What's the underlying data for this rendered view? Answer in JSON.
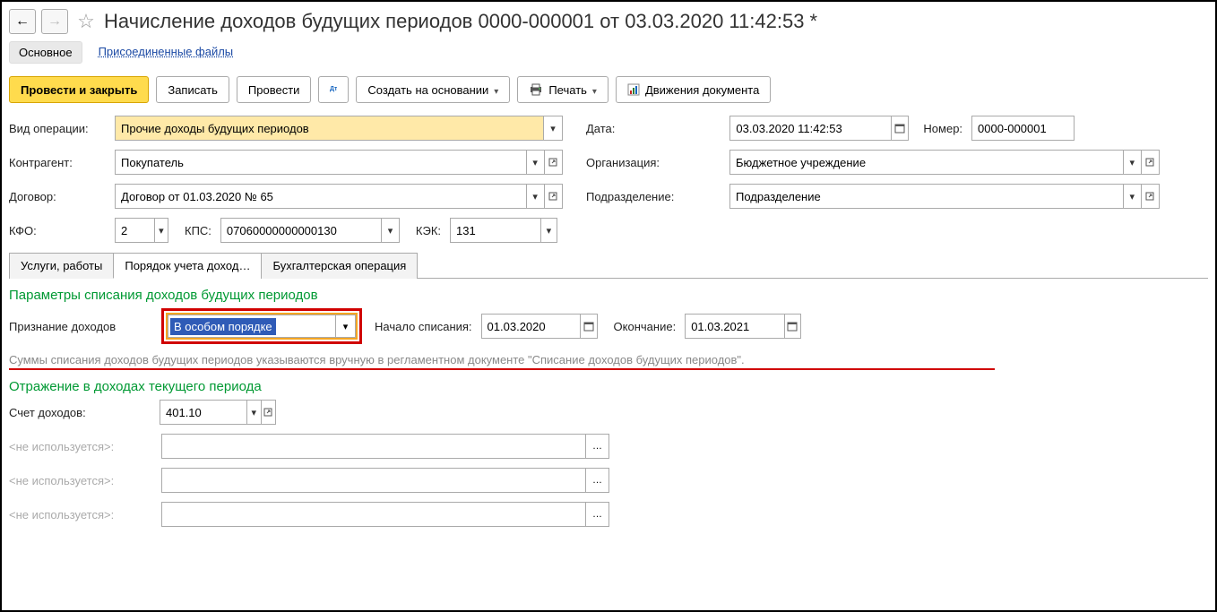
{
  "header": {
    "title": "Начисление доходов будущих периодов 0000-000001 от 03.03.2020 11:42:53 *"
  },
  "subnav": {
    "main": "Основное",
    "attachments": "Присоединенные файлы"
  },
  "toolbar": {
    "post_close": "Провести и закрыть",
    "save": "Записать",
    "post": "Провести",
    "create_based": "Создать на основании",
    "print": "Печать",
    "movements": "Движения документа"
  },
  "form": {
    "op_type_label": "Вид операции:",
    "op_type_value": "Прочие доходы будущих периодов",
    "date_label": "Дата:",
    "date_value": "03.03.2020 11:42:53",
    "number_label": "Номер:",
    "number_value": "0000-000001",
    "counterparty_label": "Контрагент:",
    "counterparty_value": "Покупатель",
    "org_label": "Организация:",
    "org_value": "Бюджетное учреждение",
    "contract_label": "Договор:",
    "contract_value": "Договор от 01.03.2020 № 65",
    "dept_label": "Подразделение:",
    "dept_value": "Подразделение",
    "kfo_label": "КФО:",
    "kfo_value": "2",
    "kps_label": "КПС:",
    "kps_value": "07060000000000130",
    "kek_label": "КЭК:",
    "kek_value": "131"
  },
  "tabs": {
    "services": "Услуги, работы",
    "order": "Порядок учета доход…",
    "accounting": "Бухгалтерская операция"
  },
  "section1": {
    "title": "Параметры списания доходов будущих периодов",
    "recog_label": "Признание доходов",
    "recog_value": "В особом порядке",
    "start_label": "Начало списания:",
    "start_value": "01.03.2020",
    "end_label": "Окончание:",
    "end_value": "01.03.2021",
    "hint": "Суммы списания доходов будущих периодов указываются вручную в регламентном документе \"Списание доходов будущих периодов\"."
  },
  "section2": {
    "title": "Отражение в доходах текущего периода",
    "acct_label": "Счет доходов:",
    "acct_value": "401.10",
    "unused_label": "<не используется>:"
  }
}
